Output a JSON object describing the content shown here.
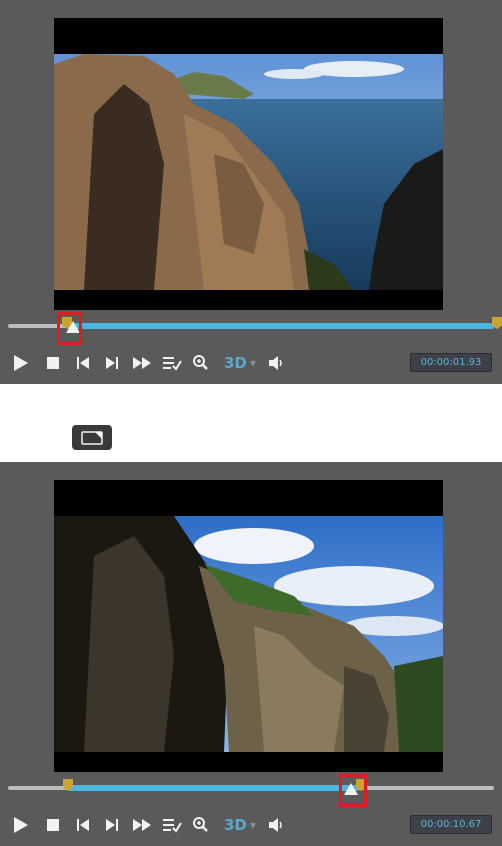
{
  "player_top": {
    "time": "00:00:01.93",
    "progress": {
      "in_marker": 0.12,
      "playhead": 0.13,
      "out_marker": 1.0
    }
  },
  "player_bottom": {
    "time": "00:00:10.67",
    "progress": {
      "in_marker": 0.12,
      "playhead": 0.71,
      "out_marker": 0.72
    }
  },
  "controls": {
    "three_d_label": "3D",
    "icons": [
      "play-icon",
      "stop-icon",
      "previous-frame-icon",
      "next-frame-icon",
      "fast-forward-icon",
      "playlist-icon",
      "zoom-icon",
      "3d-dropdown-icon",
      "volume-icon"
    ]
  },
  "mid_button": {
    "icon": "trim-icon"
  },
  "colors": {
    "panel": "#5a5a5a",
    "range": "#49b8e0",
    "marker": "#c9a633",
    "highlight": "#e01c1c",
    "time_text": "#55b8dd"
  }
}
